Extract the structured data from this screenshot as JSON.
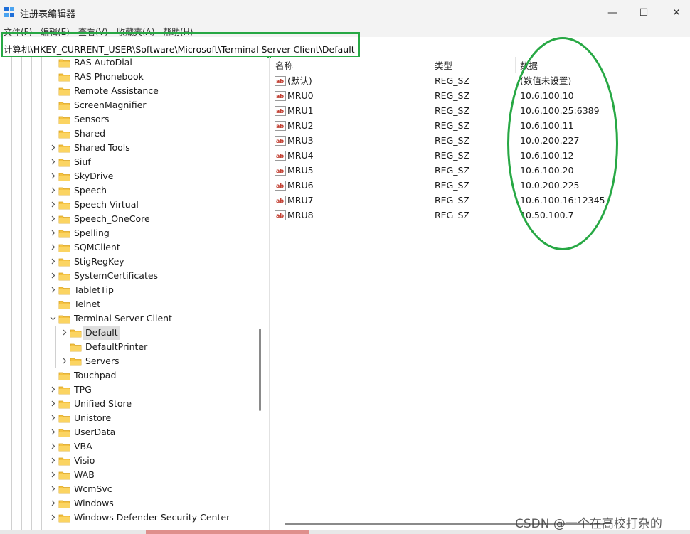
{
  "window": {
    "title": "注册表编辑器",
    "minimize": "—",
    "maximize": "☐",
    "close": "✕"
  },
  "menu": [
    "文件(F)",
    "编辑(E)",
    "查看(V)",
    "收藏夹(A)",
    "帮助(H)"
  ],
  "address": {
    "path": "计算机\\HKEY_CURRENT_USER\\Software\\Microsoft\\Terminal Server Client\\Default"
  },
  "colors": {
    "folder": "#f5c342",
    "annotation": "#27a844",
    "selection": "#dedede",
    "ab_icon": "#c0392b"
  },
  "tree": {
    "items": [
      {
        "label": "RAS AutoDial",
        "level": 0,
        "expander": "none"
      },
      {
        "label": "RAS Phonebook",
        "level": 0,
        "expander": "none"
      },
      {
        "label": "Remote Assistance",
        "level": 0,
        "expander": "none"
      },
      {
        "label": "ScreenMagnifier",
        "level": 0,
        "expander": "none"
      },
      {
        "label": "Sensors",
        "level": 0,
        "expander": "none"
      },
      {
        "label": "Shared",
        "level": 0,
        "expander": "none"
      },
      {
        "label": "Shared Tools",
        "level": 0,
        "expander": "collapsed"
      },
      {
        "label": "Siuf",
        "level": 0,
        "expander": "collapsed"
      },
      {
        "label": "SkyDrive",
        "level": 0,
        "expander": "collapsed"
      },
      {
        "label": "Speech",
        "level": 0,
        "expander": "collapsed"
      },
      {
        "label": "Speech Virtual",
        "level": 0,
        "expander": "collapsed"
      },
      {
        "label": "Speech_OneCore",
        "level": 0,
        "expander": "collapsed"
      },
      {
        "label": "Spelling",
        "level": 0,
        "expander": "collapsed"
      },
      {
        "label": "SQMClient",
        "level": 0,
        "expander": "collapsed"
      },
      {
        "label": "StigRegKey",
        "level": 0,
        "expander": "collapsed"
      },
      {
        "label": "SystemCertificates",
        "level": 0,
        "expander": "collapsed"
      },
      {
        "label": "TabletTip",
        "level": 0,
        "expander": "collapsed"
      },
      {
        "label": "Telnet",
        "level": 0,
        "expander": "none"
      },
      {
        "label": "Terminal Server Client",
        "level": 0,
        "expander": "expanded"
      },
      {
        "label": "Default",
        "level": 1,
        "expander": "collapsed",
        "selected": true
      },
      {
        "label": "DefaultPrinter",
        "level": 1,
        "expander": "none"
      },
      {
        "label": "Servers",
        "level": 1,
        "expander": "collapsed"
      },
      {
        "label": "Touchpad",
        "level": 0,
        "expander": "none"
      },
      {
        "label": "TPG",
        "level": 0,
        "expander": "collapsed"
      },
      {
        "label": "Unified Store",
        "level": 0,
        "expander": "collapsed"
      },
      {
        "label": "Unistore",
        "level": 0,
        "expander": "collapsed"
      },
      {
        "label": "UserData",
        "level": 0,
        "expander": "collapsed"
      },
      {
        "label": "VBA",
        "level": 0,
        "expander": "collapsed"
      },
      {
        "label": "Visio",
        "level": 0,
        "expander": "collapsed"
      },
      {
        "label": "WAB",
        "level": 0,
        "expander": "collapsed"
      },
      {
        "label": "WcmSvc",
        "level": 0,
        "expander": "collapsed"
      },
      {
        "label": "Windows",
        "level": 0,
        "expander": "collapsed"
      },
      {
        "label": "Windows Defender Security Center",
        "level": 0,
        "expander": "collapsed"
      }
    ]
  },
  "values": {
    "columns": {
      "name": "名称",
      "type": "类型",
      "data": "数据"
    },
    "rows": [
      {
        "name": "(默认)",
        "type": "REG_SZ",
        "data": "(数值未设置)"
      },
      {
        "name": "MRU0",
        "type": "REG_SZ",
        "data": "10.6.100.10"
      },
      {
        "name": "MRU1",
        "type": "REG_SZ",
        "data": "10.6.100.25:6389"
      },
      {
        "name": "MRU2",
        "type": "REG_SZ",
        "data": "10.6.100.11"
      },
      {
        "name": "MRU3",
        "type": "REG_SZ",
        "data": "10.0.200.227"
      },
      {
        "name": "MRU4",
        "type": "REG_SZ",
        "data": "10.6.100.12"
      },
      {
        "name": "MRU5",
        "type": "REG_SZ",
        "data": "10.6.100.20"
      },
      {
        "name": "MRU6",
        "type": "REG_SZ",
        "data": "10.0.200.225"
      },
      {
        "name": "MRU7",
        "type": "REG_SZ",
        "data": "10.6.100.16:12345"
      },
      {
        "name": "MRU8",
        "type": "REG_SZ",
        "data": "10.50.100.7"
      }
    ]
  },
  "watermark": "CSDN @一个在高校打杂的"
}
